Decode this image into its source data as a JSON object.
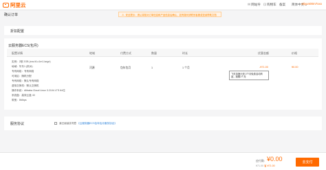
{
  "header": {
    "logo_text": "阿里云",
    "nav": [
      {
        "icon": "message-icon",
        "label": "网站导"
      },
      {
        "icon": "cart-icon",
        "label": "购物车"
      },
      {
        "icon": "",
        "label": "备案"
      },
      {
        "icon": "",
        "label": "简体中文 ⌄"
      }
    ],
    "user": "aliyun00m7xxx"
  },
  "page": {
    "title": "确认订单",
    "warning": "安全提示：请认真核对订单信息和产品信息后确认，如有疑问请联系客服或查阅帮助文档"
  },
  "section_config": {
    "title": "折扣配置"
  },
  "section_product": {
    "title": "云服务器ECS(包月)"
  },
  "table": {
    "headers": [
      "配置详情",
      "地域",
      "付费方式",
      "数量",
      "时长",
      "优惠金额",
      "价格"
    ],
    "config_lines": [
      "实例：2核 2GB (ecs.t6-c1m1.large)",
      "地域：华东1 (杭州)",
      "专有网络：专有网络",
      "可用区：随机分配",
      "专有网络：默认专有网络",
      "虚拟交换机：默认交换机",
      "操作系统：Alibaba Cloud Linux 3.2104 LTS 64位",
      "系统盘：高效云盘 40",
      "带宽：5Mbps"
    ],
    "region": "河源",
    "billing": "包年包月",
    "quantity": "1",
    "duration": "1 个月",
    "discount": "-¥71.00",
    "price": "¥0.00",
    "tip": "飞天加速计划·2个月免费活动商品，续期1个月"
  },
  "agreement": {
    "section_title": "服务协议",
    "text": "我已阅读并同意",
    "link": "《云服务器ECS包年包月服务协议》"
  },
  "footer": {
    "total_label": "应付款:",
    "total_amount": "¥0.00",
    "saved_prefix": "¥71.00",
    "saved_text": "省 ¥71.00",
    "pay_button": "去支付"
  },
  "colors": {
    "accent": "#ff6a00",
    "link": "#1e7ad6"
  }
}
